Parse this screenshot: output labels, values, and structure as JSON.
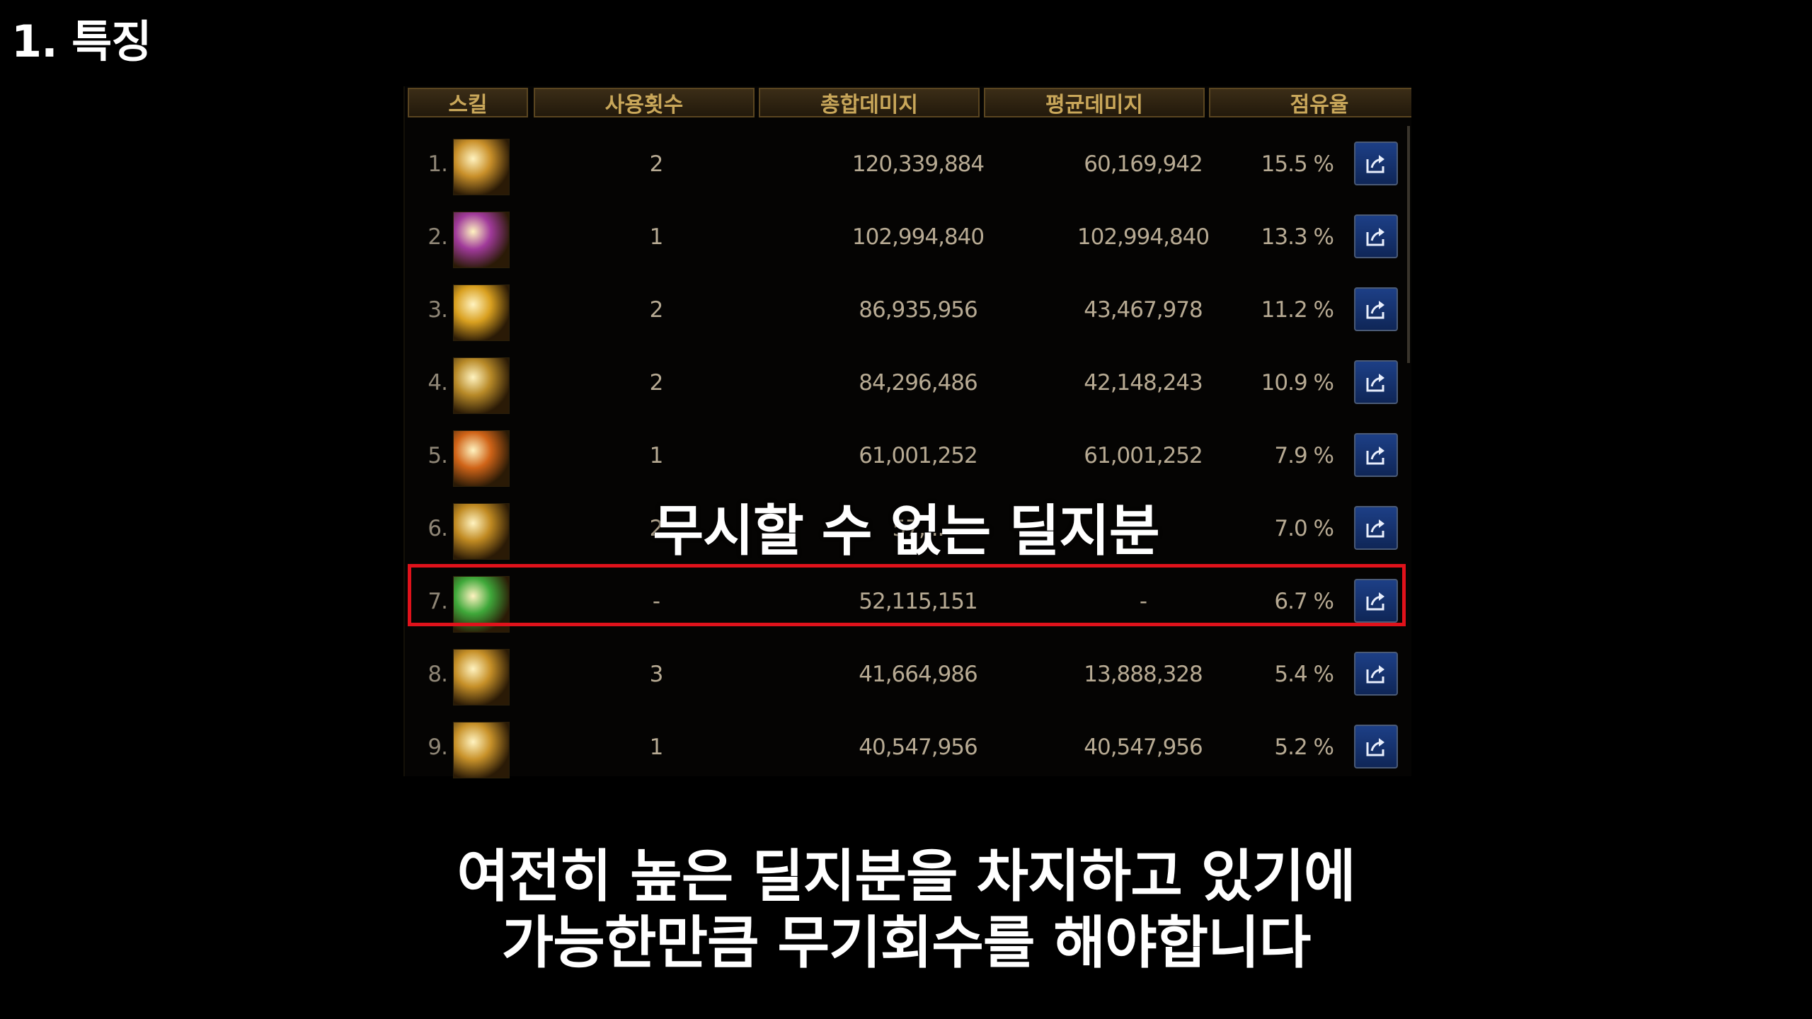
{
  "section_title": "1. 특징",
  "table": {
    "headers": [
      "스킬",
      "사용횟수",
      "총합데미지",
      "평균데미지",
      "점유율"
    ],
    "rows": [
      {
        "rank": "1.",
        "uses": "2",
        "total": "120,339,884",
        "avg": "60,169,942",
        "share": "15.5 %",
        "icon": "gold-dragon-skill-icon",
        "icon_color": "#c9902a"
      },
      {
        "rank": "2.",
        "uses": "1",
        "total": "102,994,840",
        "avg": "102,994,840",
        "share": "13.3 %",
        "icon": "purple-magic-skill-icon",
        "icon_color": "#a03a9a"
      },
      {
        "rank": "3.",
        "uses": "2",
        "total": "86,935,956",
        "avg": "43,467,978",
        "share": "11.2 %",
        "icon": "gold-burst-skill-icon",
        "icon_color": "#d9a020"
      },
      {
        "rank": "4.",
        "uses": "2",
        "total": "84,296,486",
        "avg": "42,148,243",
        "share": "10.9 %",
        "icon": "gold-sword-skill-icon",
        "icon_color": "#b88a28"
      },
      {
        "rank": "5.",
        "uses": "1",
        "total": "61,001,252",
        "avg": "61,001,252",
        "share": "7.9 %",
        "icon": "orange-strike-skill-icon",
        "icon_color": "#d06418"
      },
      {
        "rank": "6.",
        "uses": "2",
        "total": "57,...",
        "avg": "",
        "share": "7.0 %",
        "icon": "gold-swirl-skill-icon",
        "icon_color": "#c08a22"
      },
      {
        "rank": "7.",
        "uses": "-",
        "total": "52,115,151",
        "avg": "-",
        "share": "6.7 %",
        "icon": "green-crystal-skill-icon",
        "icon_color": "#3fa83a"
      },
      {
        "rank": "8.",
        "uses": "3",
        "total": "41,664,986",
        "avg": "13,888,328",
        "share": "5.4 %",
        "icon": "gold-vortex-skill-icon",
        "icon_color": "#c69028"
      },
      {
        "rank": "9.",
        "uses": "1",
        "total": "40,547,956",
        "avg": "40,547,956",
        "share": "5.2 %",
        "icon": "gold-pillar-skill-icon",
        "icon_color": "#c8922a"
      }
    ]
  },
  "overlay_caption": "무시할 수 없는 딜지분",
  "subtitle": {
    "line1": "여전히 높은 딜지분을 차지하고 있기에",
    "line2": "가능한만큼 무기회수를 해야합니다"
  },
  "colors": {
    "highlight": "#e0121b",
    "header_text": "#c9a75a",
    "share_button": "#1d3f86"
  }
}
